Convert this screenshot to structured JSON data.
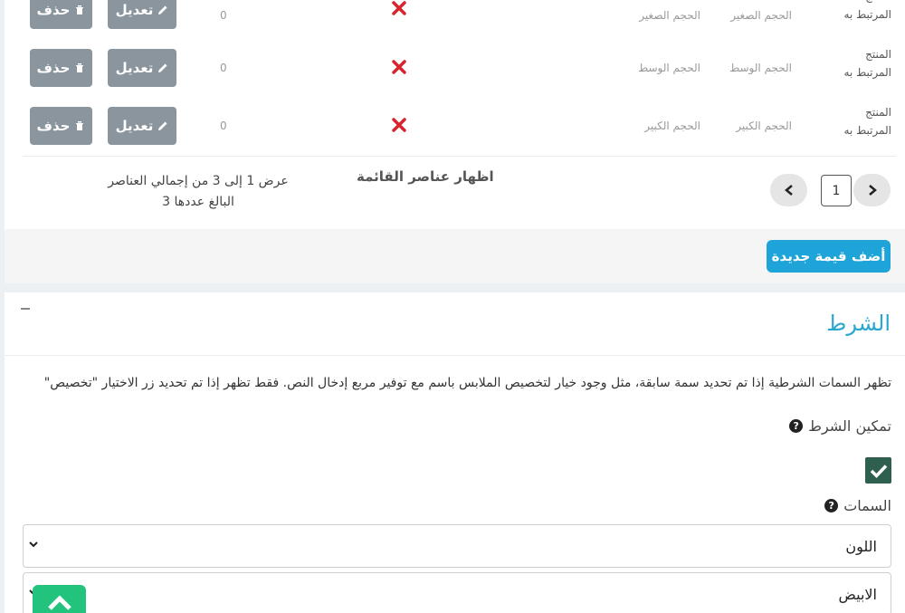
{
  "table": {
    "rows": [
      {
        "name": "المنتج المرتبط به",
        "size_ar": "الحجم الصغير",
        "size_en": "الحجم الصغير",
        "count": "0"
      },
      {
        "name": "المنتج المرتبط به",
        "size_ar": "الحجم الوسط",
        "size_en": "الحجم الوسط",
        "count": "0"
      },
      {
        "name": "المنتج المرتبط به",
        "size_ar": "الحجم الكبير",
        "size_en": "الحجم الكبير",
        "count": "0"
      }
    ],
    "edit_label": "تعديل",
    "delete_label": "حذف"
  },
  "pagination": {
    "current_page": "1",
    "show_items_label": "اظهار عناصر القائمة",
    "summary": "عرض 1 إلى 3 من إجمالي العناصر البالغ عددها 3"
  },
  "add_value_label": "أضف قيمة جديدة",
  "condition": {
    "title": "الشرط",
    "collapse_symbol": "–",
    "description": "تظهر السمات الشرطية إذا تم تحديد سمة سابقة، مثل وجود خيار لتخصيص الملابس باسم مع توفير مربع إدخال النص. فقط تظهر إذا تم تحديد زر الاختيار \"تخصيص\"",
    "enable_label": "تمكين الشرط",
    "enabled": true,
    "attributes_label": "السمات",
    "attribute_select_value": "اللون",
    "value_select_value": "الابيض"
  },
  "colors": {
    "accent": "#1ea4d8",
    "button_gray": "#8a959e",
    "danger": "#d9232d",
    "success": "#22c37d"
  }
}
